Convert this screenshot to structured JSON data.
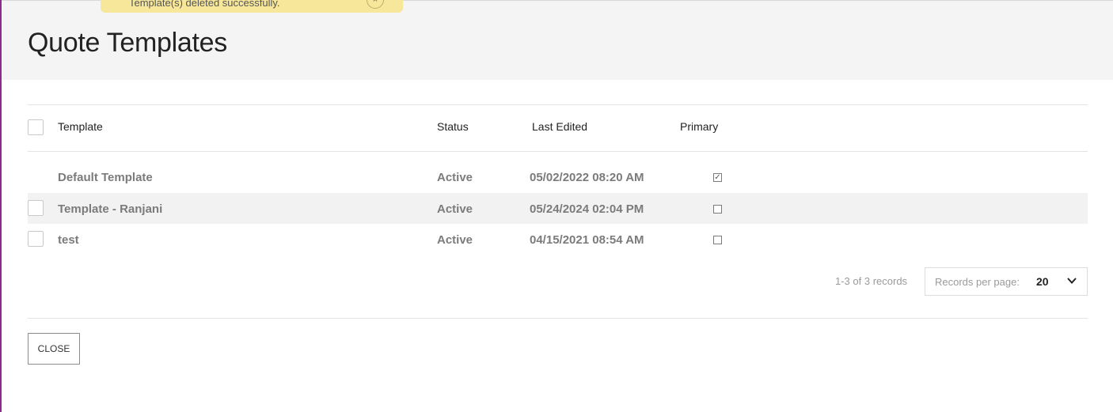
{
  "toast": {
    "message": "Template(s) deleted successfully.",
    "close_symbol": "×"
  },
  "page": {
    "title": "Quote Templates"
  },
  "table": {
    "columns": {
      "template": "Template",
      "status": "Status",
      "last_edited": "Last Edited",
      "primary": "Primary"
    },
    "rows": [
      {
        "template": "Default Template",
        "status": "Active",
        "last_edited": "05/02/2022 08:20 AM",
        "primary": true,
        "selectable": false
      },
      {
        "template": "Template - Ranjani",
        "status": "Active",
        "last_edited": "05/24/2024 02:04 PM",
        "primary": false,
        "selectable": true
      },
      {
        "template": "test",
        "status": "Active",
        "last_edited": "04/15/2021 08:54 AM",
        "primary": false,
        "selectable": true
      }
    ]
  },
  "pagination": {
    "records_text": "1-3 of 3 records",
    "per_page_label": "Records per page:",
    "per_page_value": "20"
  },
  "footer": {
    "close_label": "CLOSE"
  },
  "colors": {
    "accent_border": "#8e2a8b",
    "toast_bg": "#f7e79a",
    "header_bg": "#f4f4f4",
    "alt_row_bg": "#f2f2f2"
  },
  "icons": {
    "toast_close": "close-circle-icon",
    "dropdown": "chevron-down-icon",
    "checked": "checkmark-icon"
  }
}
